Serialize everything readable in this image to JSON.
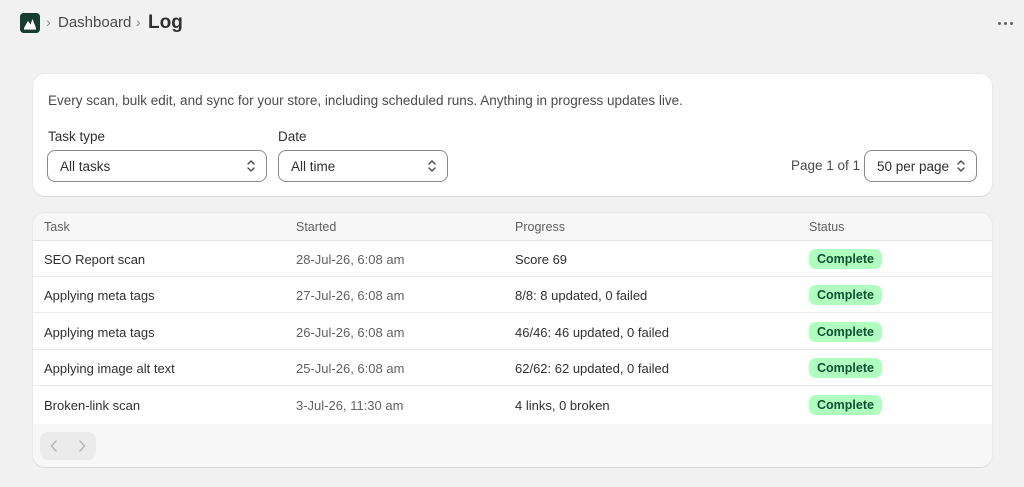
{
  "header": {
    "breadcrumb_parent": "Dashboard",
    "title": "Log",
    "separator": "›",
    "logo_icon": "mountain-logo-icon",
    "more_icon": "ellipsis-icon"
  },
  "filters": {
    "description": "Every scan, bulk edit, and sync for your store, including scheduled runs. Anything in progress updates live.",
    "task_type_label": "Task type",
    "task_type_value": "All tasks",
    "date_label": "Date",
    "date_value": "All time",
    "page_info": "Page 1 of 1",
    "per_page_value": "50 per page"
  },
  "table": {
    "headers": {
      "task": "Task",
      "started": "Started",
      "progress": "Progress",
      "status": "Status"
    },
    "rows": [
      {
        "task": "SEO Report scan",
        "started": "28-Jul-26, 6:08 am",
        "progress": "Score 69",
        "status": "Complete"
      },
      {
        "task": "Applying meta tags",
        "started": "27-Jul-26, 6:08 am",
        "progress": "8/8: 8 updated, 0 failed",
        "status": "Complete"
      },
      {
        "task": "Applying meta tags",
        "started": "26-Jul-26, 6:08 am",
        "progress": "46/46: 46 updated, 0 failed",
        "status": "Complete"
      },
      {
        "task": "Applying image alt text",
        "started": "25-Jul-26, 6:08 am",
        "progress": "62/62: 62 updated, 0 failed",
        "status": "Complete"
      },
      {
        "task": "Broken-link scan",
        "started": "3-Jul-26, 11:30 am",
        "progress": "4 links, 0 broken",
        "status": "Complete"
      }
    ],
    "pager_prev_icon": "chevron-left-icon",
    "pager_next_icon": "chevron-right-icon"
  },
  "colors": {
    "logo_bg": "#1a3d32",
    "badge_bg": "#affebf",
    "badge_text": "#0c5132",
    "page_bg": "#f1f1f1"
  }
}
